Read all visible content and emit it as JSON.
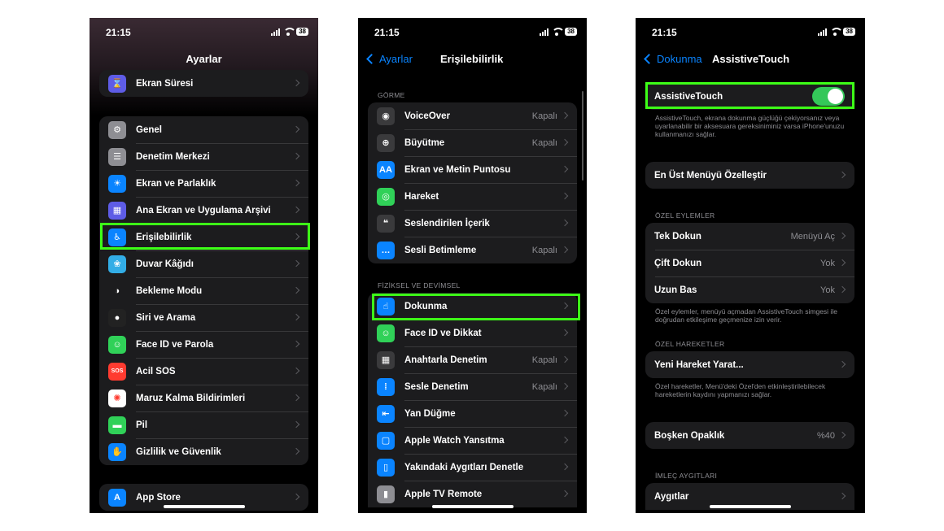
{
  "status": {
    "time": "21:15",
    "battery": "38"
  },
  "screen1": {
    "title": "Ayarlar",
    "group0": [
      {
        "label": "Ekran Süresi",
        "icon": "hourglass-icon",
        "color": "#5e5ce6",
        "glyph": "⌛"
      }
    ],
    "group1": [
      {
        "label": "Genel",
        "icon": "gear-icon",
        "color": "#8e8e93",
        "glyph": "⚙"
      },
      {
        "label": "Denetim Merkezi",
        "icon": "toggles-icon",
        "color": "#8e8e93",
        "glyph": "☰"
      },
      {
        "label": "Ekran ve Parlaklık",
        "icon": "sun-icon",
        "color": "#0a84ff",
        "glyph": "☀"
      },
      {
        "label": "Ana Ekran ve Uygulama Arşivi",
        "icon": "grid-icon",
        "color": "#5e5ce6",
        "glyph": "▦"
      },
      {
        "label": "Erişilebilirlik",
        "icon": "accessibility-icon",
        "color": "#0a84ff",
        "glyph": "♿"
      },
      {
        "label": "Duvar Kâğıdı",
        "icon": "flower-icon",
        "color": "#32ade6",
        "glyph": "❀"
      },
      {
        "label": "Bekleme Modu",
        "icon": "standby-icon",
        "color": "#1c1c1e",
        "glyph": "◑"
      },
      {
        "label": "Siri ve Arama",
        "icon": "siri-icon",
        "color": "#222",
        "glyph": "●"
      },
      {
        "label": "Face ID ve Parola",
        "icon": "faceid-icon",
        "color": "#30d158",
        "glyph": "☺"
      },
      {
        "label": "Acil SOS",
        "icon": "sos-icon",
        "color": "#ff3b30",
        "glyph": "SOS"
      },
      {
        "label": "Maruz Kalma Bildirimleri",
        "icon": "exposure-icon",
        "color": "#ffffff",
        "glyph": "✺"
      },
      {
        "label": "Pil",
        "icon": "battery-icon",
        "color": "#30d158",
        "glyph": "▬"
      },
      {
        "label": "Gizlilik ve Güvenlik",
        "icon": "hand-icon",
        "color": "#0a84ff",
        "glyph": "✋"
      }
    ],
    "group2": [
      {
        "label": "App Store",
        "icon": "appstore-icon",
        "color": "#0a84ff",
        "glyph": "A"
      }
    ]
  },
  "screen2": {
    "back": "Ayarlar",
    "title": "Erişilebilirlik",
    "section1": "GÖRME",
    "vision": [
      {
        "label": "VoiceOver",
        "value": "Kapalı",
        "icon": "voiceover-icon",
        "color": "#3a3a3c",
        "glyph": "◉"
      },
      {
        "label": "Büyütme",
        "value": "Kapalı",
        "icon": "zoom-icon",
        "color": "#3a3a3c",
        "glyph": "⊕"
      },
      {
        "label": "Ekran ve Metin Puntosu",
        "value": "",
        "icon": "text-size-icon",
        "color": "#0a84ff",
        "glyph": "AA"
      },
      {
        "label": "Hareket",
        "value": "",
        "icon": "motion-icon",
        "color": "#30d158",
        "glyph": "◎"
      },
      {
        "label": "Seslendirilen İçerik",
        "value": "",
        "icon": "spoken-content-icon",
        "color": "#3a3a3c",
        "glyph": "❝"
      },
      {
        "label": "Sesli Betimleme",
        "value": "Kapalı",
        "icon": "audio-description-icon",
        "color": "#0a84ff",
        "glyph": "…"
      }
    ],
    "section2": "FİZİKSEL VE DEVİMSEL",
    "physical": [
      {
        "label": "Dokunma",
        "value": "",
        "icon": "touch-icon",
        "color": "#0a84ff",
        "glyph": "☝"
      },
      {
        "label": "Face ID ve Dikkat",
        "value": "",
        "icon": "faceid-icon",
        "color": "#30d158",
        "glyph": "☺"
      },
      {
        "label": "Anahtarla Denetim",
        "value": "Kapalı",
        "icon": "switch-control-icon",
        "color": "#3a3a3c",
        "glyph": "▦"
      },
      {
        "label": "Sesle Denetim",
        "value": "Kapalı",
        "icon": "voice-control-icon",
        "color": "#0a84ff",
        "glyph": "⁞"
      },
      {
        "label": "Yan Düğme",
        "value": "",
        "icon": "side-button-icon",
        "color": "#0a84ff",
        "glyph": "⇤"
      },
      {
        "label": "Apple Watch Yansıtma",
        "value": "",
        "icon": "watch-mirroring-icon",
        "color": "#0a84ff",
        "glyph": "▢"
      },
      {
        "label": "Yakındaki Aygıtları Denetle",
        "value": "",
        "icon": "nearby-devices-icon",
        "color": "#0a84ff",
        "glyph": "▯"
      },
      {
        "label": "Apple TV Remote",
        "value": "",
        "icon": "tv-remote-icon",
        "color": "#8e8e93",
        "glyph": "▮"
      }
    ]
  },
  "screen3": {
    "back": "Dokunma",
    "title": "AssistiveTouch",
    "toggle_label": "AssistiveTouch",
    "toggle_on": true,
    "toggle_desc": "AssistiveTouch, ekrana dokunma güçlüğü çekiyorsanız veya uyarlanabilir bir aksesuara gereksiniminiz varsa iPhone'unuzu kullanmanızı sağlar.",
    "customize": "En Üst Menüyü Özelleştir",
    "section_actions": "ÖZEL EYLEMLER",
    "actions": [
      {
        "label": "Tek Dokun",
        "value": "Menüyü Aç"
      },
      {
        "label": "Çift Dokun",
        "value": "Yok"
      },
      {
        "label": "Uzun Bas",
        "value": "Yok"
      }
    ],
    "actions_desc": "Özel eylemler, menüyü açmadan AssistiveTouch simgesi ile doğrudan etkileşime geçmenize izin verir.",
    "section_gestures": "ÖZEL HAREKETLER",
    "new_gesture": "Yeni Hareket Yarat...",
    "gestures_desc": "Özel hareketler, Menü'deki Özel'den etkinleştirilebilecek hareketlerin kaydını yapmanızı sağlar.",
    "idle_label": "Boşken Opaklık",
    "idle_value": "%40",
    "section_pointer": "İMLEÇ AYGITLARI",
    "devices": "Aygıtlar"
  }
}
